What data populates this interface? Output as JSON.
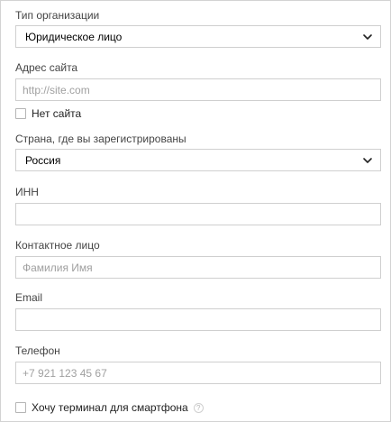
{
  "org_type": {
    "label": "Тип организации",
    "value": "Юридическое лицо"
  },
  "website": {
    "label": "Адрес сайта",
    "placeholder": "http://site.com",
    "value": ""
  },
  "no_website": {
    "label": "Нет сайта",
    "checked": false
  },
  "country": {
    "label": "Страна, где вы зарегистрированы",
    "value": "Россия"
  },
  "inn": {
    "label": "ИНН",
    "placeholder": "",
    "value": ""
  },
  "contact": {
    "label": "Контактное лицо",
    "placeholder": "Фамилия Имя",
    "value": ""
  },
  "email": {
    "label": "Email",
    "placeholder": "",
    "value": ""
  },
  "phone": {
    "label": "Телефон",
    "placeholder": "+7 921 123 45 67",
    "value": ""
  },
  "smartphone_terminal": {
    "label": "Хочу терминал для смартфона",
    "checked": false,
    "help_icon": "?"
  },
  "icons": {
    "dropdown": "chevron-down-icon",
    "help": "question-circle-icon"
  },
  "colors": {
    "border": "#cfcfcf",
    "label": "#444444",
    "placeholder": "#a0a0a0"
  }
}
